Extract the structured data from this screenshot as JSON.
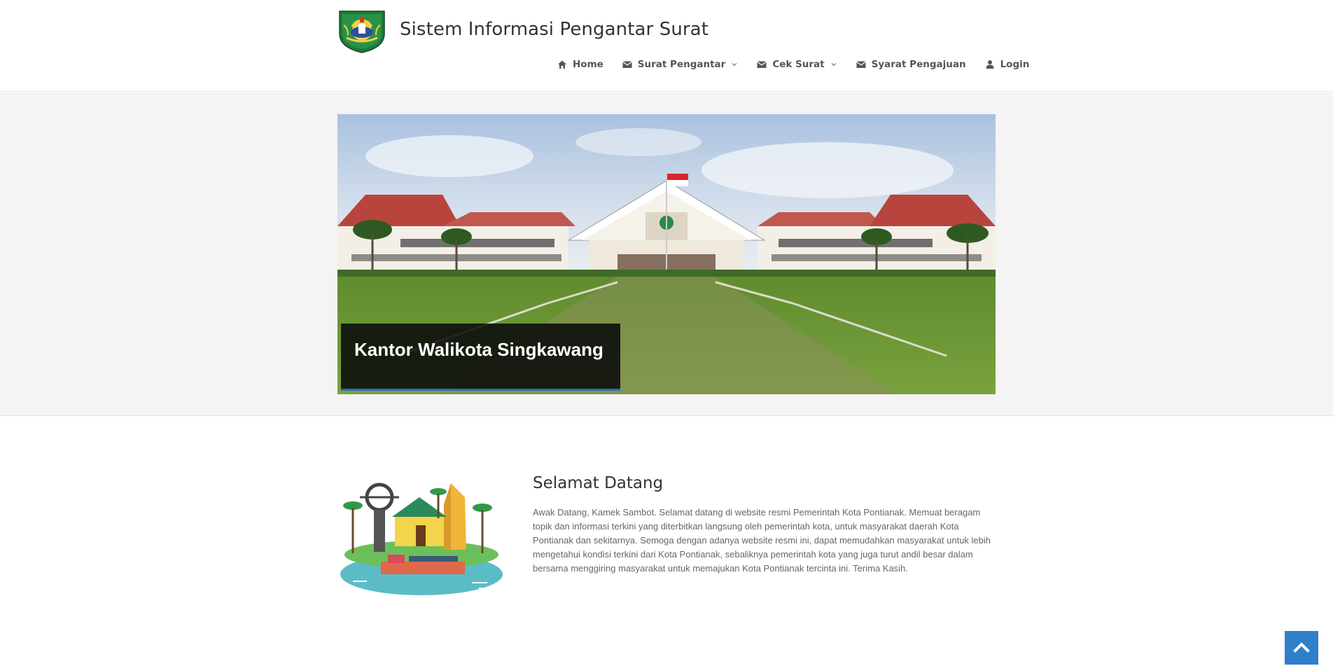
{
  "header": {
    "site_title": "Sistem Informasi Pengantar Surat",
    "logo": "kota-singkawang-emblem"
  },
  "nav": {
    "items": [
      {
        "label": "Home",
        "icon": "home-icon"
      },
      {
        "label": "Surat Pengantar",
        "icon": "envelope-icon",
        "dropdown": true
      },
      {
        "label": "Cek Surat",
        "icon": "envelope-icon",
        "dropdown": true
      },
      {
        "label": "Syarat Pengajuan",
        "icon": "envelope-icon"
      },
      {
        "label": "Login",
        "icon": "user-icon"
      }
    ]
  },
  "slider": {
    "caption": "Kantor Walikota Singkawang",
    "image": "kantor-walikota-photo"
  },
  "welcome": {
    "title": "Selamat Datang",
    "text": "Awak Datang, Kamek Sambot. Selamat datang di website resmi Pemerintah Kota Pontianak. Memuat beragam topik dan informasi terkini yang diterbitkan langsung oleh pemerintah kota, untuk masyarakat daerah Kota Pontianak dan sekitarnya. Semoga dengan adanya website resmi ini, dapat memudahkan masyarakat untuk lebih mengetahui kondisi terkini dari Kota Pontianak, sebaliknya pemerintah kota yang juga turut andil besar dalam bersama menggiring masyarakat untuk memajukan Kota Pontianak tercinta ini. Terima Kasih."
  },
  "colors": {
    "accent": "#2f7fcb",
    "nav_text": "#555555",
    "band_bg": "#f4f4f4"
  },
  "back_to_top": {
    "icon": "chevron-up-icon"
  }
}
